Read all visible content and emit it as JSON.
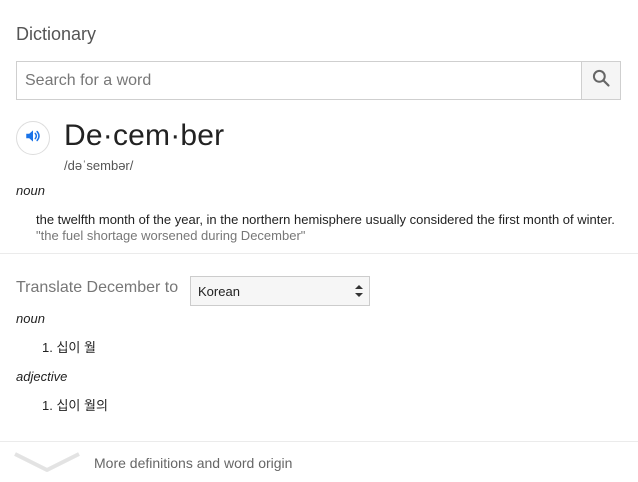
{
  "header": {
    "title": "Dictionary"
  },
  "search": {
    "placeholder": "Search for a word"
  },
  "entry": {
    "headword": "De·cem·ber",
    "pronunciation": "/dəˈsembər/",
    "senses": [
      {
        "pos": "noun",
        "definition": "the twelfth month of the year, in the northern hemisphere usually considered the first month of winter.",
        "example": "\"the fuel shortage worsened during December\""
      }
    ]
  },
  "translate": {
    "label": "Translate December to",
    "language": "Korean",
    "groups": [
      {
        "pos": "noun",
        "items": [
          "1. 십이 월"
        ]
      },
      {
        "pos": "adjective",
        "items": [
          "1. 십이 월의"
        ]
      }
    ]
  },
  "footer": {
    "more_label": "More definitions and word origin"
  },
  "colors": {
    "accent": "#1a73e8",
    "text": "#222222",
    "muted": "#777777",
    "border": "#cfcfcf"
  },
  "icons": {
    "search": "search-icon",
    "audio": "speaker-icon",
    "expand": "chevron-down-icon"
  }
}
